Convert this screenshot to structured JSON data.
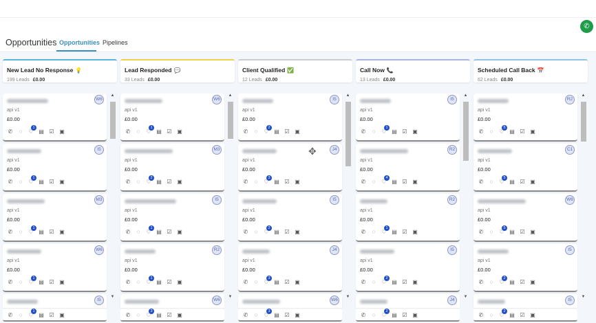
{
  "header": {
    "title": "Opportunities",
    "tabs": [
      {
        "label": "Opportunities",
        "active": true
      },
      {
        "label": "Pipelines",
        "active": false
      }
    ]
  },
  "colors": {
    "accent": "#3b8fbf",
    "call_button": "#1e9c4a",
    "badge": "#1f4fc7"
  },
  "columns": [
    {
      "name": "New Lead No Response",
      "icon": "lightbulb-icon",
      "glyph": "💡",
      "leads": "199 Leads",
      "value": "£0.00",
      "border": "#5bb4dc",
      "cards": [
        {
          "avatar": "W6",
          "badge": "1"
        },
        {
          "avatar": "I5",
          "badge": "1"
        },
        {
          "avatar": "M3",
          "badge": "1"
        },
        {
          "avatar": "W6",
          "badge": "1"
        },
        {
          "avatar": "I5",
          "badge": "1"
        }
      ]
    },
    {
      "name": "Lead Responded",
      "icon": "speech-bubble-icon",
      "glyph": "💬",
      "leads": "33 Leads",
      "value": "£0.00",
      "border": "#f0d24a",
      "cards": [
        {
          "avatar": "W6",
          "badge": "1"
        },
        {
          "avatar": "M3",
          "badge": "2"
        },
        {
          "avatar": "I5",
          "badge": "1"
        },
        {
          "avatar": "R2",
          "badge": "1"
        },
        {
          "avatar": "W6",
          "badge": "3"
        }
      ]
    },
    {
      "name": "Client Qualified",
      "icon": "green-check-icon",
      "glyph": "✅",
      "leads": "12 Leads",
      "value": "£0.00",
      "border": "#c8ccd4",
      "cards": [
        {
          "avatar": "I5",
          "badge": "2"
        },
        {
          "avatar": "J4",
          "badge": "3"
        },
        {
          "avatar": "I5",
          "badge": "2"
        },
        {
          "avatar": "J4",
          "badge": "3"
        },
        {
          "avatar": "W6",
          "badge": "3"
        }
      ]
    },
    {
      "name": "Call Now",
      "icon": "phone-icon",
      "glyph": "📞",
      "leads": "13 Leads",
      "value": "£0.00",
      "border": "#a9b4e0",
      "cards": [
        {
          "avatar": "I5",
          "badge": "1"
        },
        {
          "avatar": "R2",
          "badge": "4"
        },
        {
          "avatar": "R2",
          "badge": "1"
        },
        {
          "avatar": "I5",
          "badge": "2"
        },
        {
          "avatar": "J4",
          "badge": "2"
        }
      ]
    },
    {
      "name": "Scheduled Call Back",
      "icon": "calendar-icon",
      "glyph": "📅",
      "leads": "62 Leads",
      "value": "£0.00",
      "border": "#8cc3e6",
      "cards": [
        {
          "avatar": "R2",
          "badge": "5"
        },
        {
          "avatar": "C1",
          "badge": "5"
        },
        {
          "avatar": "W6",
          "badge": "5"
        },
        {
          "avatar": "I5",
          "badge": "2"
        },
        {
          "avatar": "I5",
          "badge": "2"
        }
      ]
    }
  ],
  "card_source": "api v1",
  "card_value": "£0.00"
}
